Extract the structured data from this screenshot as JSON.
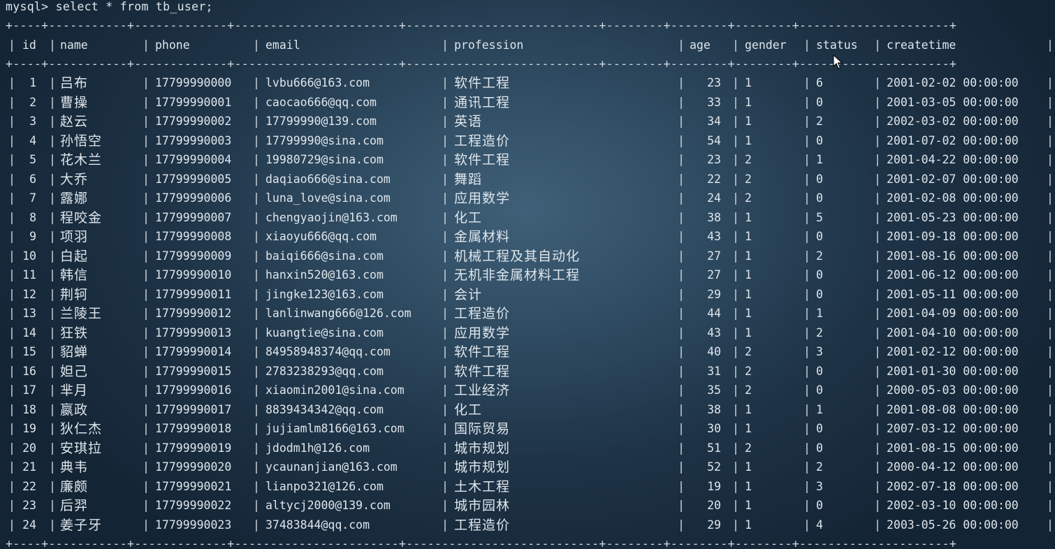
{
  "terminal": {
    "prompt": "mysql> select * from tb_user;",
    "border": "+----+-----------+-------------+-----------------------+---------------------------+--------+--------+--------+---------------------+"
  },
  "table": {
    "columns": [
      "id",
      "name",
      "phone",
      "email",
      "profession",
      "age",
      "gender",
      "status",
      "createtime"
    ],
    "rows": [
      [
        "1",
        "吕布",
        "17799990000",
        "lvbu666@163.com",
        "软件工程",
        "23",
        "1",
        "6",
        "2001-02-02 00:00:00"
      ],
      [
        "2",
        "曹操",
        "17799990001",
        "caocao666@qq.com",
        "通讯工程",
        "33",
        "1",
        "0",
        "2001-03-05 00:00:00"
      ],
      [
        "3",
        "赵云",
        "17799990002",
        "17799990@139.com",
        "英语",
        "34",
        "1",
        "2",
        "2002-03-02 00:00:00"
      ],
      [
        "4",
        "孙悟空",
        "17799990003",
        "17799990@sina.com",
        "工程造价",
        "54",
        "1",
        "0",
        "2001-07-02 00:00:00"
      ],
      [
        "5",
        "花木兰",
        "17799990004",
        "19980729@sina.com",
        "软件工程",
        "23",
        "2",
        "1",
        "2001-04-22 00:00:00"
      ],
      [
        "6",
        "大乔",
        "17799990005",
        "daqiao666@sina.com",
        "舞蹈",
        "22",
        "2",
        "0",
        "2001-02-07 00:00:00"
      ],
      [
        "7",
        "露娜",
        "17799990006",
        "luna_love@sina.com",
        "应用数学",
        "24",
        "2",
        "0",
        "2001-02-08 00:00:00"
      ],
      [
        "8",
        "程咬金",
        "17799990007",
        "chengyaojin@163.com",
        "化工",
        "38",
        "1",
        "5",
        "2001-05-23 00:00:00"
      ],
      [
        "9",
        "项羽",
        "17799990008",
        "xiaoyu666@qq.com",
        "金属材料",
        "43",
        "1",
        "0",
        "2001-09-18 00:00:00"
      ],
      [
        "10",
        "白起",
        "17799990009",
        "baiqi666@sina.com",
        "机械工程及其自动化",
        "27",
        "1",
        "2",
        "2001-08-16 00:00:00"
      ],
      [
        "11",
        "韩信",
        "17799990010",
        "hanxin520@163.com",
        "无机非金属材料工程",
        "27",
        "1",
        "0",
        "2001-06-12 00:00:00"
      ],
      [
        "12",
        "荆轲",
        "17799990011",
        "jingke123@163.com",
        "会计",
        "29",
        "1",
        "0",
        "2001-05-11 00:00:00"
      ],
      [
        "13",
        "兰陵王",
        "17799990012",
        "lanlinwang666@126.com",
        "工程造价",
        "44",
        "1",
        "1",
        "2001-04-09 00:00:00"
      ],
      [
        "14",
        "狂铁",
        "17799990013",
        "kuangtie@sina.com",
        "应用数学",
        "43",
        "1",
        "2",
        "2001-04-10 00:00:00"
      ],
      [
        "15",
        "貂蝉",
        "17799990014",
        "84958948374@qq.com",
        "软件工程",
        "40",
        "2",
        "3",
        "2001-02-12 00:00:00"
      ],
      [
        "16",
        "妲己",
        "17799990015",
        "2783238293@qq.com",
        "软件工程",
        "31",
        "2",
        "0",
        "2001-01-30 00:00:00"
      ],
      [
        "17",
        "芈月",
        "17799990016",
        "xiaomin2001@sina.com",
        "工业经济",
        "35",
        "2",
        "0",
        "2000-05-03 00:00:00"
      ],
      [
        "18",
        "嬴政",
        "17799990017",
        "8839434342@qq.com",
        "化工",
        "38",
        "1",
        "1",
        "2001-08-08 00:00:00"
      ],
      [
        "19",
        "狄仁杰",
        "17799990018",
        "jujiamlm8166@163.com",
        "国际贸易",
        "30",
        "1",
        "0",
        "2007-03-12 00:00:00"
      ],
      [
        "20",
        "安琪拉",
        "17799990019",
        "jdodm1h@126.com",
        "城市规划",
        "51",
        "2",
        "0",
        "2001-08-15 00:00:00"
      ],
      [
        "21",
        "典韦",
        "17799990020",
        "ycaunanjian@163.com",
        "城市规划",
        "52",
        "1",
        "2",
        "2000-04-12 00:00:00"
      ],
      [
        "22",
        "廉颇",
        "17799990021",
        "lianpo321@126.com",
        "土木工程",
        "19",
        "1",
        "3",
        "2002-07-18 00:00:00"
      ],
      [
        "23",
        "后羿",
        "17799990022",
        "altycj2000@139.com",
        "城市园林",
        "20",
        "1",
        "0",
        "2002-03-10 00:00:00"
      ],
      [
        "24",
        "姜子牙",
        "17799990023",
        "37483844@qq.com",
        "工程造价",
        "29",
        "1",
        "4",
        "2003-05-26 00:00:00"
      ]
    ]
  },
  "icons": {
    "cursor": "mouse-pointer-icon"
  },
  "colors": {
    "text": "#dfe6ec",
    "background_center": "#3f6078",
    "background_edge": "#132434"
  }
}
